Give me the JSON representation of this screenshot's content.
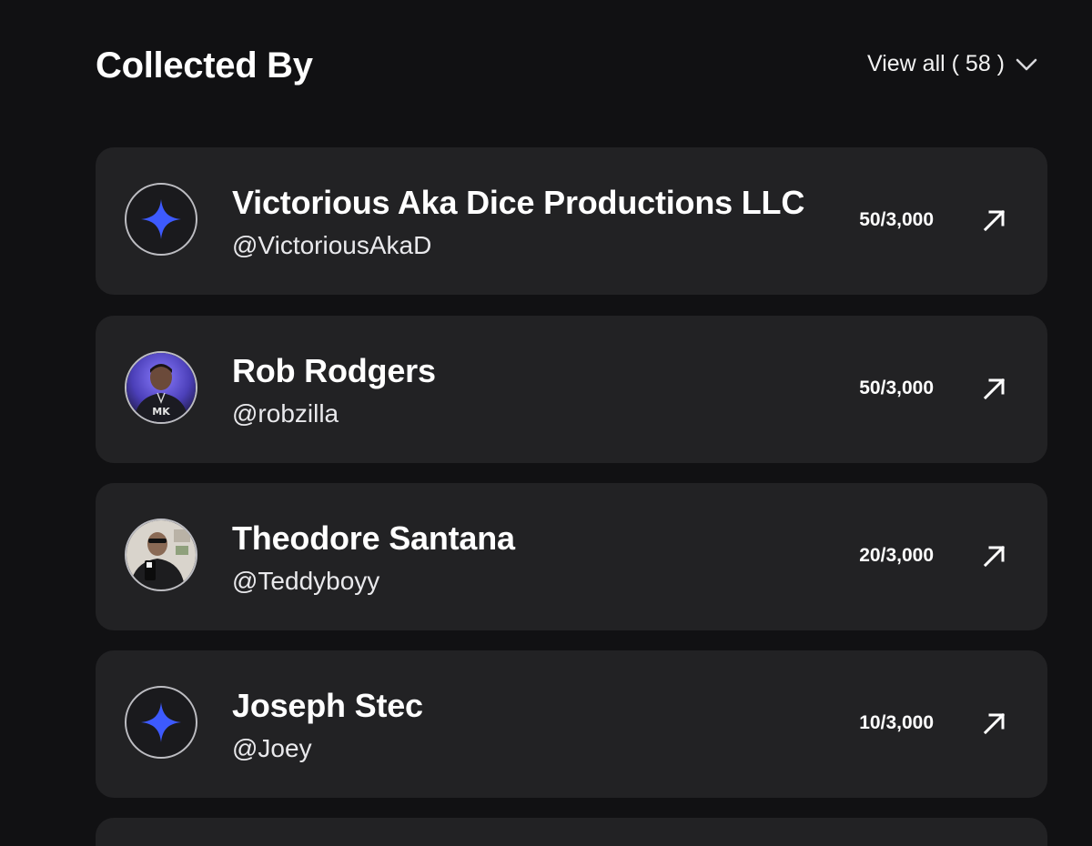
{
  "section": {
    "title": "Collected By",
    "view_all_label": "View all ( 58 )"
  },
  "collectors": [
    {
      "name": "Victorious Aka Dice Productions LLC",
      "handle": "@VictoriousAkaD",
      "count": "50/3,000",
      "avatar": "star-placeholder"
    },
    {
      "name": "Rob Rodgers",
      "handle": "@robzilla",
      "count": "50/3,000",
      "avatar": "photo"
    },
    {
      "name": "Theodore Santana",
      "handle": "@Teddyboyy",
      "count": "20/3,000",
      "avatar": "photo"
    },
    {
      "name": "Joseph Stec",
      "handle": "@Joey",
      "count": "10/3,000",
      "avatar": "star-placeholder"
    }
  ],
  "icons": {
    "view_all": "chevron-down-icon",
    "row_action": "arrow-up-right-icon",
    "placeholder_avatar": "sparkle-star-icon"
  },
  "colors": {
    "background": "#111113",
    "card": "#222224",
    "star": "#3d5afe",
    "text": "#ffffff"
  }
}
